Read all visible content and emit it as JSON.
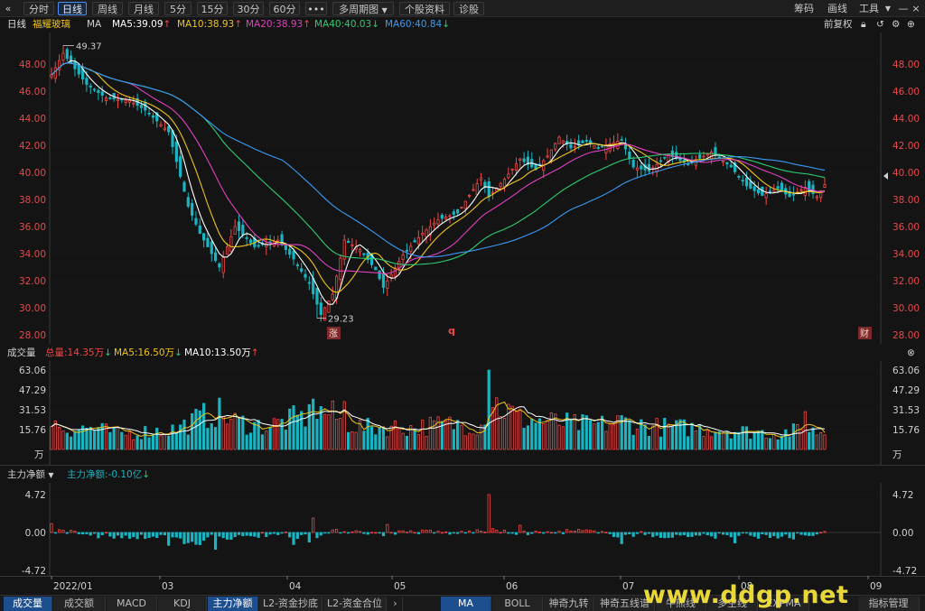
{
  "toolbar": {
    "left": [
      "分时",
      "日线",
      "周线",
      "月线",
      "5分",
      "15分",
      "30分",
      "60分"
    ],
    "more": "•••",
    "multi": "多周期图",
    "profile": "个股资料",
    "diagnose": "诊股",
    "right": [
      "筹码",
      "画线",
      "工具"
    ]
  },
  "header": {
    "period": "日线",
    "name": "福耀玻璃",
    "ma_label": "MA",
    "adjust": "前复权"
  },
  "ma": [
    {
      "name": "MA5",
      "value": "39.09",
      "dir": "↑",
      "color": "#ffffff"
    },
    {
      "name": "MA10",
      "value": "38.93",
      "dir": "↑",
      "color": "#f0c419"
    },
    {
      "name": "MA20",
      "value": "38.93",
      "dir": "↑",
      "color": "#e040c0"
    },
    {
      "name": "MA40",
      "value": "40.03",
      "dir": "↓",
      "color": "#2ecc71"
    },
    {
      "name": "MA60",
      "value": "40.84",
      "dir": "↓",
      "color": "#3a9af5"
    }
  ],
  "price_axis": [
    "48.00",
    "46.00",
    "44.00",
    "42.00",
    "40.00",
    "38.00",
    "36.00",
    "34.00",
    "32.00",
    "30.00",
    "28.00"
  ],
  "price_high": "49.37",
  "price_low": "29.23",
  "markers": {
    "rise": "涨",
    "q": "q",
    "fin": "财"
  },
  "volume": {
    "label": "成交量",
    "total": "总量:14.35万",
    "total_dir": "↓",
    "ma5": "MA5:16.50万",
    "ma5_dir": "↓",
    "ma10": "MA10:13.50万",
    "ma10_dir": "↑",
    "axis": [
      "63.06",
      "47.29",
      "31.53",
      "15.76"
    ],
    "unit": "万"
  },
  "flow": {
    "label": "主力净额",
    "value": "主力净额:-0.10亿",
    "dir": "↓",
    "axis": [
      "4.72",
      "0.00",
      "-4.72"
    ]
  },
  "dates": [
    "2022/01",
    "03",
    "04",
    "05",
    "06",
    "07",
    "08",
    "09"
  ],
  "tabs": [
    "成交量",
    "成交额",
    "MACD",
    "KDJ",
    "主力净额",
    "L2-资金抄底",
    "L2-资金合位"
  ],
  "right_tabs": [
    "MA",
    "BOLL",
    "神奇九转",
    "神奇五线谱",
    "牛熊线",
    "多空线",
    "EXPMA"
  ],
  "end_tab": "指标管理",
  "watermark": "www.ddgp.net",
  "colors": {
    "up": "#f04848",
    "down": "#1ab5c2",
    "axis_red": "#e84a4a",
    "bg": "#141414"
  },
  "chart_data": {
    "type": "candlestick",
    "yaxis": [
      28,
      48
    ],
    "anchors": [
      [
        0,
        47.2
      ],
      [
        3,
        48.8
      ],
      [
        9,
        46.5
      ],
      [
        14,
        45.5
      ],
      [
        20,
        45.3
      ],
      [
        24,
        44.6
      ],
      [
        30,
        43.0
      ],
      [
        35,
        37.5
      ],
      [
        38,
        35.5
      ],
      [
        43,
        33.0
      ],
      [
        47,
        36.0
      ],
      [
        52,
        34.5
      ],
      [
        58,
        35.0
      ],
      [
        62,
        33.6
      ],
      [
        66,
        31.8
      ],
      [
        69,
        29.5
      ],
      [
        72,
        31.0
      ],
      [
        75,
        35.0
      ],
      [
        79,
        34.3
      ],
      [
        83,
        32.8
      ],
      [
        85,
        31.5
      ],
      [
        90,
        33.9
      ],
      [
        95,
        35.5
      ],
      [
        99,
        36.5
      ],
      [
        104,
        37.0
      ],
      [
        110,
        39.6
      ],
      [
        112,
        38.2
      ],
      [
        116,
        39.5
      ],
      [
        120,
        41.0
      ],
      [
        124,
        40.2
      ],
      [
        127,
        41.2
      ],
      [
        130,
        42.6
      ],
      [
        133,
        41.8
      ],
      [
        137,
        42.3
      ],
      [
        140,
        41.8
      ],
      [
        146,
        42.4
      ],
      [
        149,
        40.4
      ],
      [
        153,
        40.1
      ],
      [
        158,
        41.3
      ],
      [
        163,
        40.6
      ],
      [
        169,
        41.5
      ],
      [
        174,
        40.4
      ],
      [
        178,
        39.0
      ],
      [
        182,
        38.3
      ],
      [
        186,
        38.8
      ],
      [
        189,
        38.2
      ],
      [
        193,
        38.9
      ],
      [
        196,
        38.2
      ],
      [
        198,
        39.1
      ]
    ],
    "volume_anchors": [
      [
        0,
        22
      ],
      [
        4,
        16
      ],
      [
        10,
        17
      ],
      [
        18,
        12
      ],
      [
        24,
        14
      ],
      [
        32,
        16
      ],
      [
        36,
        22
      ],
      [
        42,
        30
      ],
      [
        47,
        22
      ],
      [
        55,
        18
      ],
      [
        62,
        24
      ],
      [
        67,
        27
      ],
      [
        70,
        30
      ],
      [
        75,
        22
      ],
      [
        80,
        17
      ],
      [
        86,
        18
      ],
      [
        92,
        17
      ],
      [
        98,
        19
      ],
      [
        104,
        20
      ],
      [
        110,
        19
      ],
      [
        112,
        40
      ],
      [
        120,
        24
      ],
      [
        127,
        22
      ],
      [
        133,
        20
      ],
      [
        140,
        19
      ],
      [
        146,
        22
      ],
      [
        153,
        18
      ],
      [
        163,
        17
      ],
      [
        171,
        16
      ],
      [
        178,
        14
      ],
      [
        186,
        13
      ],
      [
        192,
        15
      ],
      [
        198,
        14
      ]
    ],
    "flow_anchors": [
      [
        0,
        0.3
      ],
      [
        6,
        0.1
      ],
      [
        12,
        -0.3
      ],
      [
        18,
        -0.6
      ],
      [
        24,
        -0.5
      ],
      [
        30,
        -1.1
      ],
      [
        36,
        -1.0
      ],
      [
        42,
        -0.8
      ],
      [
        48,
        -0.5
      ],
      [
        54,
        -0.2
      ],
      [
        60,
        -0.3
      ],
      [
        66,
        -0.6
      ],
      [
        72,
        0.1
      ],
      [
        78,
        0.2
      ],
      [
        84,
        -0.2
      ],
      [
        90,
        0.1
      ],
      [
        96,
        0.1
      ],
      [
        104,
        -0.1
      ],
      [
        112,
        0.3
      ],
      [
        120,
        -0.1
      ],
      [
        128,
        0.0
      ],
      [
        136,
        0.2
      ],
      [
        144,
        -0.3
      ],
      [
        152,
        -0.2
      ],
      [
        160,
        -0.4
      ],
      [
        168,
        -0.3
      ],
      [
        176,
        -0.5
      ],
      [
        184,
        -0.4
      ],
      [
        192,
        -0.4
      ],
      [
        198,
        -0.1
      ]
    ]
  }
}
